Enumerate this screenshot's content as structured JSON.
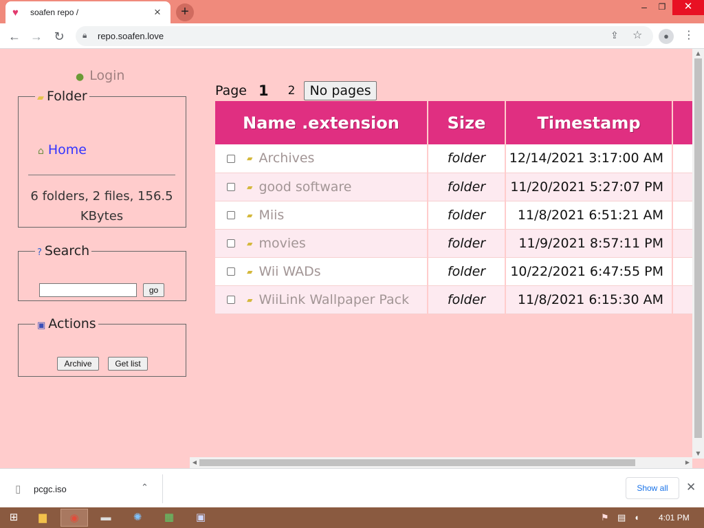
{
  "browser": {
    "tab_title": "soafen repo /",
    "url": "repo.soafen.love"
  },
  "sidebar": {
    "login": "Login",
    "folder_box": {
      "legend": "Folder",
      "home_link": "Home",
      "stats": "6 folders, 2 files, 156.5 KBytes"
    },
    "search_box": {
      "legend": "Search",
      "input_value": "",
      "go_label": "go"
    },
    "actions_box": {
      "legend": "Actions",
      "archive_label": "Archive",
      "getlist_label": "Get list"
    }
  },
  "pager": {
    "label": "Page",
    "current": "1",
    "next": "2",
    "nopages_label": "No pages"
  },
  "table": {
    "headers": [
      "Name .extension",
      "Size",
      "Timestamp",
      ""
    ],
    "rows": [
      {
        "name": "Archives",
        "size": "folder",
        "timestamp": "12/14/2021 3:17:00 AM"
      },
      {
        "name": "good software",
        "size": "folder",
        "timestamp": "11/20/2021 5:27:07 PM"
      },
      {
        "name": "Miis",
        "size": "folder",
        "timestamp": "11/8/2021 6:51:21 AM"
      },
      {
        "name": "movies",
        "size": "folder",
        "timestamp": "11/9/2021 8:57:11 PM"
      },
      {
        "name": "Wii WADs",
        "size": "folder",
        "timestamp": "10/22/2021 6:47:55 PM"
      },
      {
        "name": "WiiLink Wallpaper Pack",
        "size": "folder",
        "timestamp": "11/8/2021 6:15:30 AM"
      }
    ]
  },
  "downloads": {
    "file_name": "pcgc.iso",
    "show_all_label": "Show all"
  },
  "taskbar": {
    "clock": "4:01 PM"
  },
  "colors": {
    "page_bg": "#ffcccc",
    "header_bg": "#e02f81",
    "link": "#3333ff",
    "tabstrip": "#f08a7c"
  },
  "icons": {
    "tab": "heart-icon",
    "login": "user-icon",
    "folder_legend": "folder-open-icon",
    "home": "house-icon",
    "search_legend": "help-icon",
    "actions_legend": "floppy-disk-icon",
    "row": "folder-icon"
  }
}
